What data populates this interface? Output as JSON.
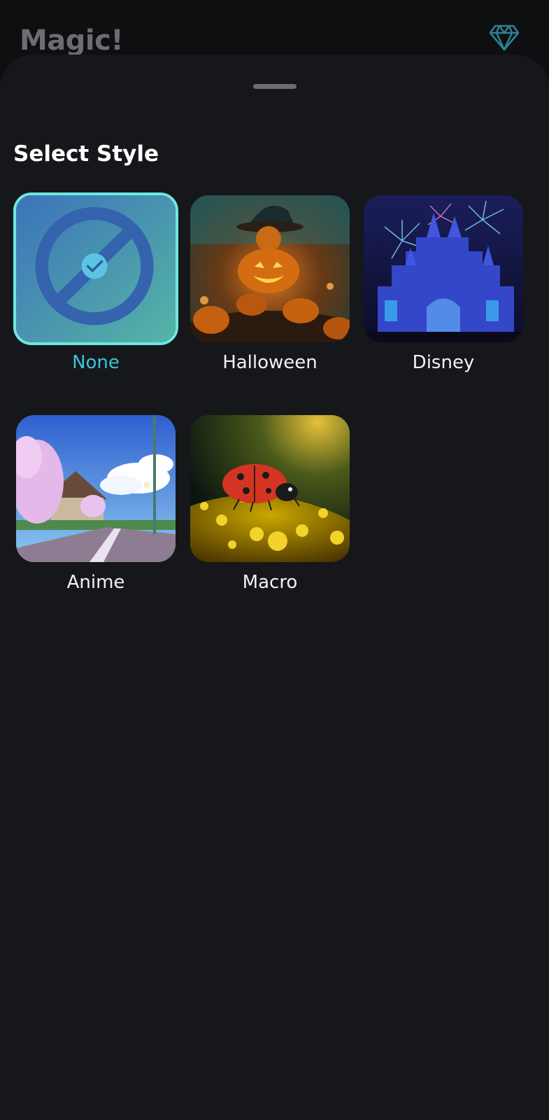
{
  "app": {
    "title": "Magic!",
    "premium_icon": "diamond-icon"
  },
  "sheet": {
    "title": "Select Style"
  },
  "styles": [
    {
      "label": "None",
      "selected": true,
      "icon": "none-ban-icon",
      "check_icon": "check-icon"
    },
    {
      "label": "Halloween",
      "selected": false
    },
    {
      "label": "Disney",
      "selected": false
    },
    {
      "label": "Anime",
      "selected": false
    },
    {
      "label": "Macro",
      "selected": false
    }
  ],
  "colors": {
    "accent": "#3fc2d8",
    "selected_border": "#6de8e3",
    "sheet_bg": "#16171a",
    "page_bg": "#0e0f10"
  }
}
